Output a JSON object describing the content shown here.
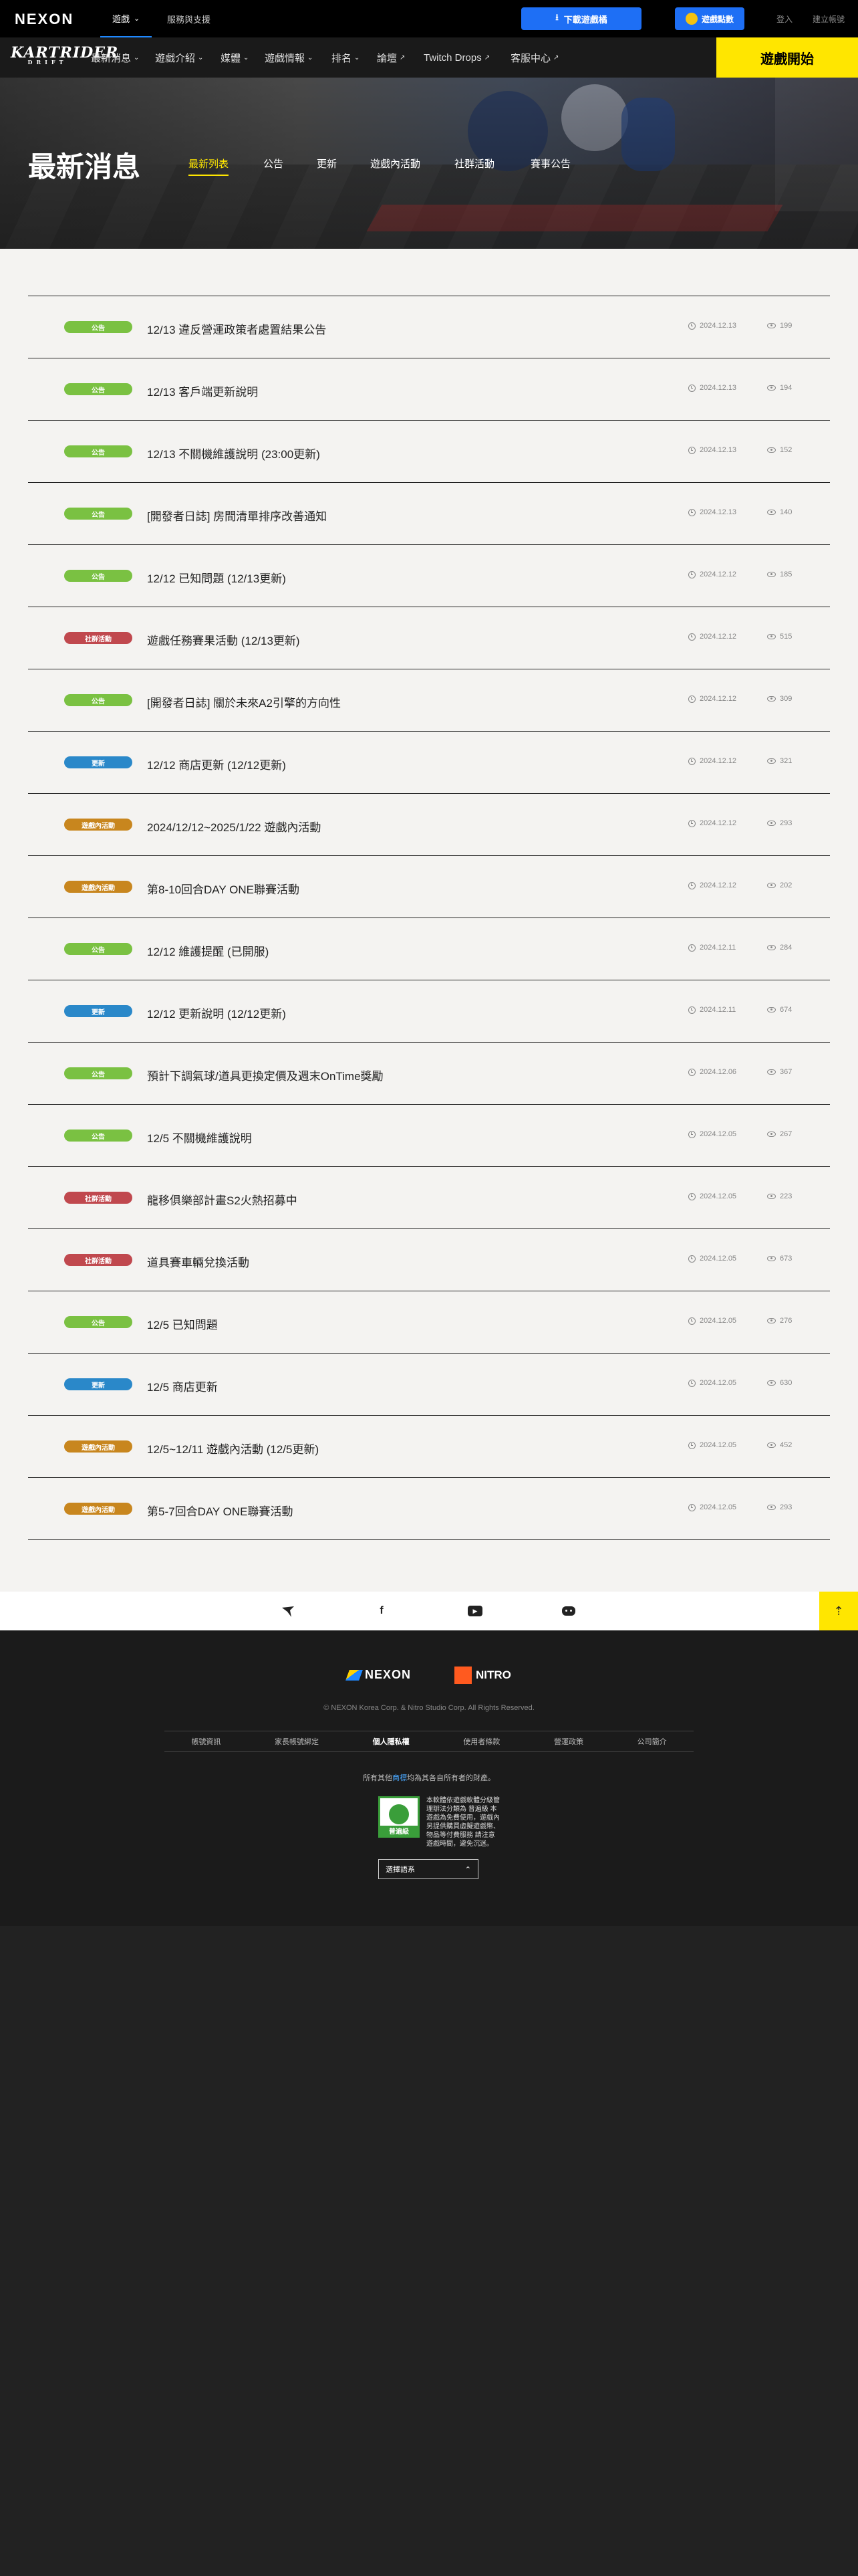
{
  "topbar": {
    "logo": "NEXON",
    "nav_games": "遊戲",
    "nav_games_chevron": "⌄",
    "nav_support": "服務與支援",
    "download_label": "下載遊戲橘",
    "download_icon": "download-icon",
    "beanfun_label": "遊戲點數",
    "login": "登入",
    "register": "建立帳號"
  },
  "game_nav": {
    "logo": "KARTRIDER",
    "logo_sub": "DRIFT",
    "items": [
      {
        "label": "最新消息",
        "chevron": "⌄"
      },
      {
        "label": "遊戲介紹",
        "chevron": "⌄"
      },
      {
        "label": "媒體",
        "chevron": "⌄"
      },
      {
        "label": "遊戲情報",
        "chevron": "⌄"
      },
      {
        "label": "排名",
        "chevron": "⌄"
      },
      {
        "label": "論壇",
        "chevron": "↗"
      },
      {
        "label": "Twitch Drops",
        "chevron": "↗"
      },
      {
        "label": "客服中心",
        "chevron": "↗"
      }
    ],
    "play_button": "遊戲開始"
  },
  "hero": {
    "title": "最新消息",
    "tabs": [
      "最新列表",
      "公告",
      "更新",
      "遊戲內活動",
      "社群活動",
      "賽事公告"
    ],
    "active_tab": "最新列表"
  },
  "news": [
    {
      "category": "公告",
      "type": "notice",
      "title": "12/13 違反營運政策者處置結果公告",
      "date": "2024.12.13",
      "views": "199"
    },
    {
      "category": "公告",
      "type": "notice",
      "title": "12/13 客戶端更新說明",
      "date": "2024.12.13",
      "views": "194"
    },
    {
      "category": "公告",
      "type": "notice",
      "title": "12/13 不關機維護說明 (23:00更新)",
      "date": "2024.12.13",
      "views": "152"
    },
    {
      "category": "公告",
      "type": "notice",
      "title": "[開發者日誌] 房間清單排序改善通知",
      "date": "2024.12.13",
      "views": "140"
    },
    {
      "category": "公告",
      "type": "notice",
      "title": "12/12 已知問題 (12/13更新)",
      "date": "2024.12.12",
      "views": "185"
    },
    {
      "category": "社群活動",
      "type": "community",
      "title": "遊戲任務賽果活動 (12/13更新)",
      "date": "2024.12.12",
      "views": "515"
    },
    {
      "category": "公告",
      "type": "notice",
      "title": "[開發者日誌] 關於未來A2引擎的方向性",
      "date": "2024.12.12",
      "views": "309"
    },
    {
      "category": "更新",
      "type": "update",
      "title": "12/12 商店更新 (12/12更新)",
      "date": "2024.12.12",
      "views": "321"
    },
    {
      "category": "遊戲內活動",
      "type": "ingame",
      "title": "2024/12/12~2025/1/22 遊戲內活動",
      "date": "2024.12.12",
      "views": "293"
    },
    {
      "category": "遊戲內活動",
      "type": "ingame",
      "title": "第8-10回合DAY ONE聯賽活動",
      "date": "2024.12.12",
      "views": "202"
    },
    {
      "category": "公告",
      "type": "notice",
      "title": "12/12 維護提醒 (已開服)",
      "date": "2024.12.11",
      "views": "284"
    },
    {
      "category": "更新",
      "type": "update",
      "title": "12/12 更新說明 (12/12更新)",
      "date": "2024.12.11",
      "views": "674"
    },
    {
      "category": "公告",
      "type": "notice",
      "title": "預計下調氣球/道具更換定價及週末OnTime獎勵",
      "date": "2024.12.06",
      "views": "367"
    },
    {
      "category": "公告",
      "type": "notice",
      "title": "12/5 不關機維護說明",
      "date": "2024.12.05",
      "views": "267"
    },
    {
      "category": "社群活動",
      "type": "community",
      "title": "龍移俱樂部計畫S2火熱招募中",
      "date": "2024.12.05",
      "views": "223"
    },
    {
      "category": "社群活動",
      "type": "community",
      "title": "道具賽車輛兌換活動",
      "date": "2024.12.05",
      "views": "673"
    },
    {
      "category": "公告",
      "type": "notice",
      "title": "12/5 已知問題",
      "date": "2024.12.05",
      "views": "276"
    },
    {
      "category": "更新",
      "type": "update",
      "title": "12/5 商店更新",
      "date": "2024.12.05",
      "views": "630"
    },
    {
      "category": "遊戲內活動",
      "type": "ingame",
      "title": "12/5~12/11 遊戲內活動 (12/5更新)",
      "date": "2024.12.05",
      "views": "452"
    },
    {
      "category": "遊戲內活動",
      "type": "ingame",
      "title": "第5-7回合DAY ONE聯賽活動",
      "date": "2024.12.05",
      "views": "293"
    }
  ],
  "social": {
    "icons": [
      "kartrider-icon",
      "facebook-icon",
      "youtube-icon",
      "discord-icon"
    ],
    "facebook_glyph": "f",
    "youtube_glyph": "▶",
    "top_button": "⇡"
  },
  "footer": {
    "nexon": "NEXON",
    "nitro": "NITRO",
    "copyright": "© NEXON Korea Corp. & Nitro Studio Corp. All Rights Reserved.",
    "links": [
      "帳號資訊",
      "家長帳號綁定",
      "個人隱私權",
      "使用者條款",
      "營運政策",
      "公司簡介"
    ],
    "owner_prefix": "所有其他",
    "owner_highlight": "商標",
    "owner_suffix": "均為其各自所有者的財產。",
    "rating_label": "普遍級",
    "rating_text": "本軟體依遊戲軟體分級管理辦法分類為 普遍級 本遊戲為免費使用，遊戲內另提供購買虛擬遊戲幣、物品等付費服務 請注意遊戲時間，避免沉迷。",
    "language": "選擇語系",
    "language_chevron": "⌃"
  },
  "colors": {
    "notice": "#7ac142",
    "community": "#c0484e",
    "update": "#2a88c9",
    "ingame": "#c8861e",
    "accent": "#ffe600",
    "brand_blue": "#1e6ff5"
  }
}
